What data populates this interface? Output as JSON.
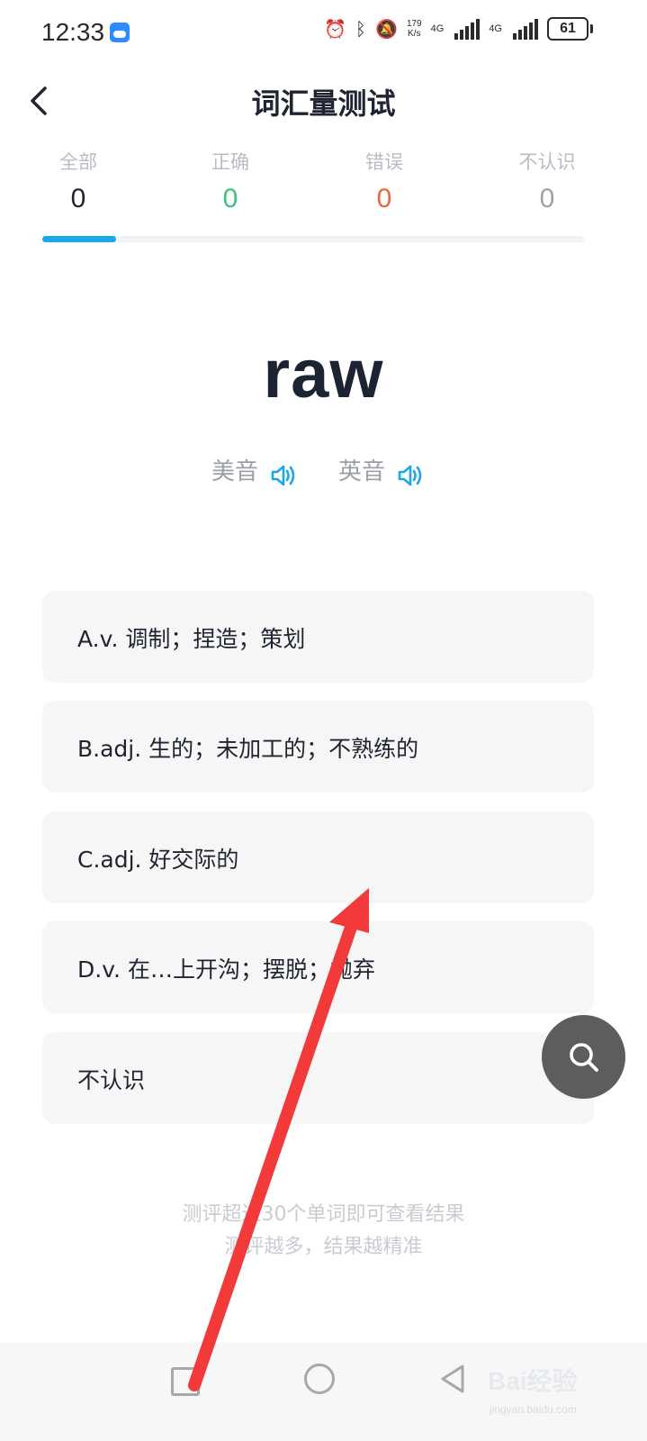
{
  "status_bar": {
    "time": "12:33",
    "net_speed_top": "179",
    "net_speed_bottom": "K/s",
    "network_1": "4G",
    "network_2": "4G",
    "battery": "61",
    "icons": [
      "weather-icon",
      "alarm-icon",
      "bluetooth-icon",
      "bell-off-icon",
      "signal-icon",
      "battery-icon"
    ]
  },
  "header": {
    "title": "词汇量测试",
    "back_icon": "chevron-left-icon"
  },
  "tabs": [
    {
      "label": "全部",
      "count": "0",
      "color": "#1f2430"
    },
    {
      "label": "正确",
      "count": "0",
      "color": "#3cc27a"
    },
    {
      "label": "错误",
      "count": "0",
      "color": "#e8673c"
    },
    {
      "label": "不认识",
      "count": "0",
      "color": "#9ea3ab"
    }
  ],
  "progress": {
    "fraction": 0.137,
    "color": "#1aa8e8"
  },
  "word": {
    "text": "raw",
    "pron_us": "美音",
    "pron_uk": "英音",
    "speaker_color": "#1aa8e8"
  },
  "options": [
    {
      "text": "A.v. 调制；捏造；策划"
    },
    {
      "text": "B.adj. 生的；未加工的；不熟练的"
    },
    {
      "text": "C.adj. 好交际的"
    },
    {
      "text": "D.v. 在…上开沟；摆脱；抛弃"
    },
    {
      "text": "不认识"
    }
  ],
  "footer": {
    "hint_line1": "测评超过30个单词即可查看结果",
    "hint_line2": "测评越多，结果越精准"
  },
  "float_button": {
    "icon": "search-icon"
  },
  "watermark": {
    "brand": "Bai经验",
    "url": "jingyan.baidu.com"
  },
  "colors": {
    "accent": "#1aa8e8",
    "arrow": "#f23a3a"
  }
}
